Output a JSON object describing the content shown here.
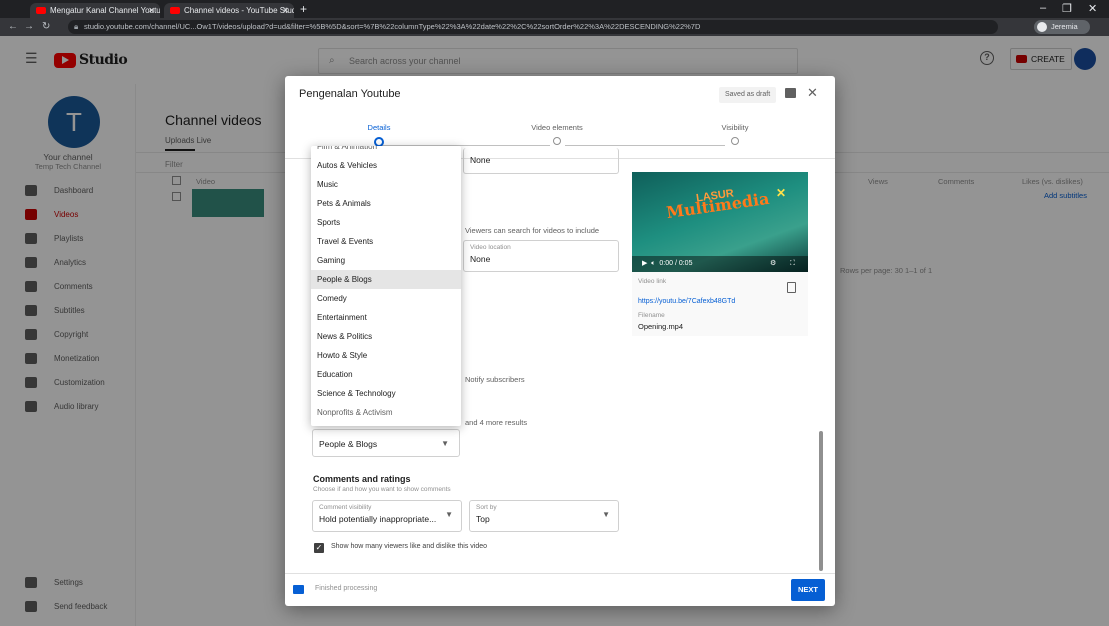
{
  "browser": {
    "tabs": [
      {
        "label": "Mengatur Kanal Channel Youtube - Yo"
      },
      {
        "label": "Channel videos - YouTube Studio"
      }
    ],
    "new_tab": "+",
    "minimize": "–",
    "restore": "❐",
    "close": "✕",
    "url": "studio.youtube.com/channel/UC...Ow1T/videos/upload?d=ud&filter=%5B%5D&sort=%7B%22columnType%22%3A%22date%22%2C%22sortOrder%22%3A%22DESCENDING%22%7D",
    "profile": "Jeremia"
  },
  "header": {
    "studio": "Studio",
    "search_placeholder": "Search across your channel",
    "create": "CREATE"
  },
  "sidebar": {
    "avatar_letter": "T",
    "channel_label": "Your channel",
    "channel_name": "Temp Tech Channel",
    "items": [
      {
        "label": "Dashboard",
        "active": false
      },
      {
        "label": "Videos",
        "active": true
      },
      {
        "label": "Playlists",
        "active": false
      },
      {
        "label": "Analytics",
        "active": false
      },
      {
        "label": "Comments",
        "active": false
      },
      {
        "label": "Subtitles",
        "active": false
      },
      {
        "label": "Copyright",
        "active": false
      },
      {
        "label": "Monetization",
        "active": false
      },
      {
        "label": "Customization",
        "active": false
      },
      {
        "label": "Audio library",
        "active": false
      }
    ],
    "bottom": [
      {
        "label": "Settings"
      },
      {
        "label": "Send feedback"
      }
    ]
  },
  "background": {
    "title": "Channel videos",
    "tabs": "Uploads    Live",
    "filter": "Filter",
    "columns": [
      "Video",
      "Views",
      "Comments",
      "Likes (vs. dislikes)"
    ],
    "row_link": "Add subtitles",
    "pager": "Rows per page: 30    1–1 of 1"
  },
  "dialog": {
    "title": "Pengenalan Youtube",
    "saved": "Saved as draft",
    "steps": [
      {
        "label": "Details",
        "active": true
      },
      {
        "label": "Video elements",
        "active": false
      },
      {
        "label": "Visibility",
        "active": false
      }
    ],
    "top_field_value": "None",
    "license_hint": "Viewers can search for videos to include",
    "location_field": {
      "label": "Video location",
      "value": "None"
    },
    "notify_text": "Notify subscribers",
    "shorts_text": "and 4 more results",
    "preview": {
      "art_title": "LASUR",
      "art_subtitle": "Multimedia",
      "time": "0:00 / 0:05",
      "link_label": "Video link",
      "link": "https://youtu.be/7Cafexb48GTd",
      "filename_label": "Filename",
      "filename": "Opening.mp4"
    },
    "categories": [
      "Film & Animation",
      "Autos & Vehicles",
      "Music",
      "Pets & Animals",
      "Sports",
      "Travel & Events",
      "Gaming",
      "People & Blogs",
      "Comedy",
      "Entertainment",
      "News & Politics",
      "Howto & Style",
      "Education",
      "Science & Technology",
      "Nonprofits & Activism"
    ],
    "selected_category": "People & Blogs",
    "comments_section": {
      "title": "Comments and ratings",
      "subtitle": "Choose if and how you want to show comments",
      "visibility_label": "Comment visibility",
      "visibility_value": "Hold potentially inappropriate...",
      "sort_label": "Sort by",
      "sort_value": "Top"
    },
    "ratings_checkbox": "Show how many viewers like and dislike this video",
    "footer_status": "Finished processing",
    "next": "NEXT"
  }
}
